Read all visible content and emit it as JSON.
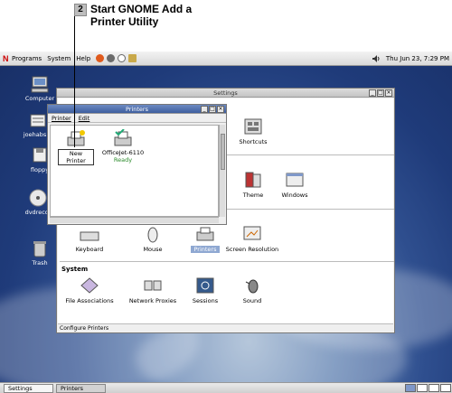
{
  "callout": {
    "number": "2",
    "text": "Start GNOME Add a Printer Utility"
  },
  "top_panel": {
    "logo": "N",
    "menus": [
      "Programs",
      "System",
      "Help"
    ],
    "clock": "Thu Jun 23, 7:29 PM",
    "volume_icon": "speaker-icon"
  },
  "desktop_icons": [
    {
      "label": "Computer"
    },
    {
      "label": "joehabs H"
    },
    {
      "label": "floppy"
    },
    {
      "label": "dvdrecor"
    },
    {
      "label": "Trash"
    }
  ],
  "settings_window": {
    "title": "Settings",
    "items_top": [
      {
        "label": "Shortcuts"
      }
    ],
    "items_row2": [
      {
        "label": "Theme"
      },
      {
        "label": "Windows"
      }
    ],
    "items_hardware": [
      {
        "label": "Keyboard"
      },
      {
        "label": "Mouse"
      },
      {
        "label": "Printers"
      },
      {
        "label": "Screen Resolution"
      }
    ],
    "system_section": "System",
    "items_system": [
      {
        "label": "File Associations"
      },
      {
        "label": "Network Proxies"
      },
      {
        "label": "Sessions"
      },
      {
        "label": "Sound"
      }
    ],
    "status": "Configure Printers"
  },
  "printers_window": {
    "title": "Printers",
    "menu": [
      "Printer",
      "Edit"
    ],
    "items": [
      {
        "label": "New Printer",
        "status": ""
      },
      {
        "label": "OfficeJet-6110",
        "status": "Ready"
      }
    ]
  },
  "taskbar": {
    "tasks": [
      {
        "label": "Settings"
      },
      {
        "label": "Printers"
      }
    ]
  },
  "colors": {
    "accent": "#3e5f9f",
    "ready_status": "#2a8a2a"
  }
}
